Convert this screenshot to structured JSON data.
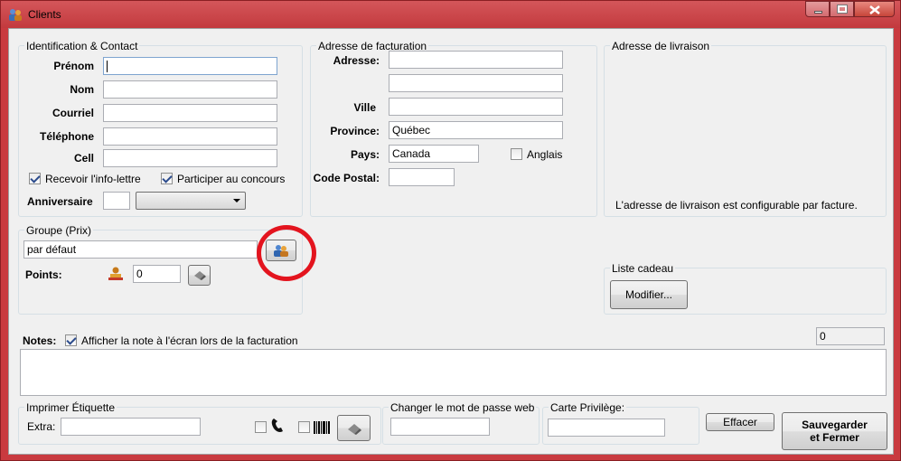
{
  "window": {
    "title": "Clients"
  },
  "identification": {
    "legend": "Identification & Contact",
    "prenom_label": "Prénom",
    "prenom_value": "",
    "nom_label": "Nom",
    "nom_value": "",
    "courriel_label": "Courriel",
    "courriel_value": "",
    "telephone_label": "Téléphone",
    "telephone_value": "",
    "cell_label": "Cell",
    "cell_value": "",
    "newsletter_label": "Recevoir l'info-lettre",
    "newsletter_checked": true,
    "contest_label": "Participer au concours",
    "contest_checked": true,
    "anniversaire_label": "Anniversaire",
    "anniversaire_day": "",
    "anniversaire_month": ""
  },
  "billing": {
    "legend": "Adresse de facturation",
    "adresse_label": "Adresse:",
    "adresse_line1": "",
    "adresse_line2": "",
    "ville_label": "Ville",
    "ville_value": "",
    "province_label": "Province:",
    "province_value": "Québec",
    "pays_label": "Pays:",
    "pays_value": "Canada",
    "anglais_label": "Anglais",
    "anglais_checked": false,
    "code_postal_label": "Code Postal:",
    "code_postal_value": ""
  },
  "delivery": {
    "legend": "Adresse de livraison",
    "note": "L'adresse de livraison est configurable par facture."
  },
  "groupe": {
    "legend": "Groupe (Prix)",
    "value": "par défaut",
    "points_label": "Points:",
    "points_value": "0"
  },
  "gift_list": {
    "legend": "Liste cadeau",
    "modify_label": "Modifier..."
  },
  "notes": {
    "label": "Notes:",
    "show_label": "Afficher la note à l'écran lors de la facturation",
    "show_checked": true,
    "counter": "0",
    "text": ""
  },
  "print_label": {
    "legend": "Imprimer Étiquette",
    "extra_label": "Extra:",
    "extra_value": "",
    "phone_checked": false,
    "barcode_checked": false
  },
  "web_password": {
    "legend": "Changer le mot de passe web",
    "value": ""
  },
  "privilege_card": {
    "legend": "Carte Privilège:",
    "value": ""
  },
  "actions": {
    "clear_label": "Effacer",
    "save_line1": "Sauvegarder",
    "save_line2": "et Fermer"
  },
  "colors": {
    "frame": "#c93a3f",
    "highlight": "#e3141e",
    "panel": "#f0f0f0"
  },
  "icons": [
    "app-icon",
    "group-select-icon",
    "points-stamp-icon",
    "eraser-icon",
    "phone-icon",
    "barcode-icon",
    "print-icon"
  ]
}
